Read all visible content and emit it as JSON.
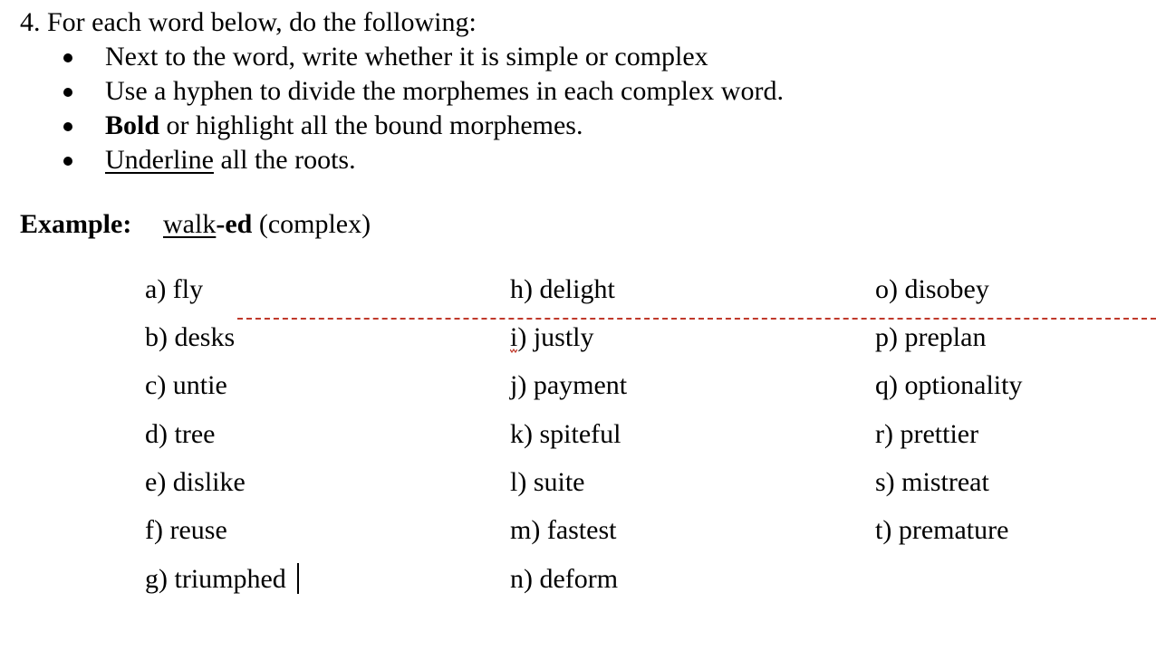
{
  "instructions": {
    "heading": "4. For each word below, do the following:",
    "bullets": [
      {
        "pre": "",
        "styled": "",
        "text": "Next to the word, write whether it is simple or complex"
      },
      {
        "pre": "",
        "styled": "",
        "text": "Use a hyphen to divide the morphemes in each complex word."
      },
      {
        "styled_bold": "Bold",
        "text": " or highlight all the bound morphemes."
      },
      {
        "styled_underline": "Underline",
        "text": " all the roots."
      }
    ]
  },
  "example": {
    "label": "Example:",
    "root": "walk",
    "separator": "-",
    "bound": "ed",
    "note": " (complex)"
  },
  "columns": [
    [
      "a) fly",
      "b) desks",
      "c) untie",
      "d) tree",
      "e) dislike",
      "f) reuse",
      "g) triumphed"
    ],
    [
      "h) delight",
      "i) justly",
      "j) payment",
      "k) spiteful",
      "l) suite",
      "m) fastest",
      "n) deform"
    ],
    [
      "o) disobey",
      "p) preplan",
      "q) optionality",
      "r) prettier",
      "s) mistreat",
      "t) premature"
    ]
  ],
  "colors": {
    "text": "#000000",
    "spellcheck_red": "#c0392b"
  }
}
